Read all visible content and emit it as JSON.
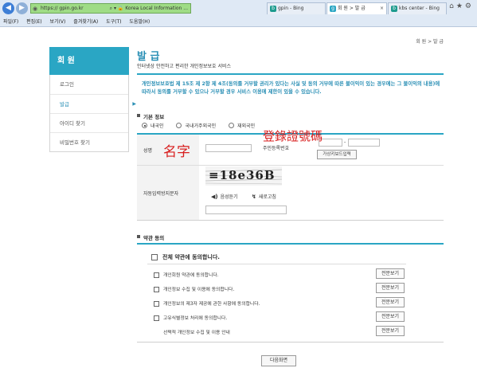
{
  "browser": {
    "url": "https://        gpin.go.kr",
    "cert_label": "Korea Local Information ...",
    "tabs": [
      {
        "title": "gpin - Bing"
      },
      {
        "title": "회 원 > 발 급"
      },
      {
        "title": "kbs center - Bing"
      }
    ],
    "menu": [
      "파일(F)",
      "편집(E)",
      "보기(V)",
      "즐겨찾기(A)",
      "도구(T)",
      "도움말(H)"
    ]
  },
  "breadcrumb": "회 원 > 발 급",
  "sidebar": {
    "title": "회 원",
    "items": [
      {
        "label": "로그인"
      },
      {
        "label": "발급"
      },
      {
        "label": "아이디 찾기"
      },
      {
        "label": "비밀번호 찾기"
      }
    ]
  },
  "main": {
    "title": "발 급",
    "subtitle": "인터넷상 안전하고 편리한 개인정보보호 서비스",
    "notice": "개인정보보호법 제 15조 제 2항 제 4조(동의를 거부할 권리가 있다는 사실 및 동의 거부에 따른 불이익이 있는 경우에는 그 불이익의 내용)에 따라서 동의를 거부할 수 있으나 거부할 경우 서비스 이용에 제한이 있을 수 있습니다."
  },
  "basic_info": {
    "section_title": "기본 정보",
    "nationality_options": [
      "내국인",
      "국내거주외국인",
      "재외국민"
    ],
    "name_label": "성명",
    "id_number_label": "주민등록번호",
    "id_separator": "-",
    "keyboard_button": "가상키보드입력",
    "captcha_label": "자동입력방지문자",
    "audio_button": "음성듣기",
    "refresh_button": "새로고침",
    "captcha_text": "≡18e36B",
    "annotation_name": "名字",
    "annotation_id": "登錄證號碼"
  },
  "terms": {
    "section_title": "약관 동의",
    "agree_all": "전체 약관에 동의합니다.",
    "items": [
      {
        "label": "개인회원 약관에 동의합니다."
      },
      {
        "label": "개인정보 수집 및 이용에 동의합니다."
      },
      {
        "label": "개인정보의 제3자 제공에 관한 사항에 동의합니다."
      },
      {
        "label": "고유식별정보 처리에 동의합니다."
      },
      {
        "label": "선택적 개인정보 수집 및 이용 안내"
      }
    ],
    "view_button": "전문보기"
  },
  "next_button": "다음화면",
  "colors": {
    "accent": "#2aa6c4",
    "link": "#2a8fb5",
    "annotation": "#d81e1e",
    "address_bar": "#9fdc86"
  }
}
